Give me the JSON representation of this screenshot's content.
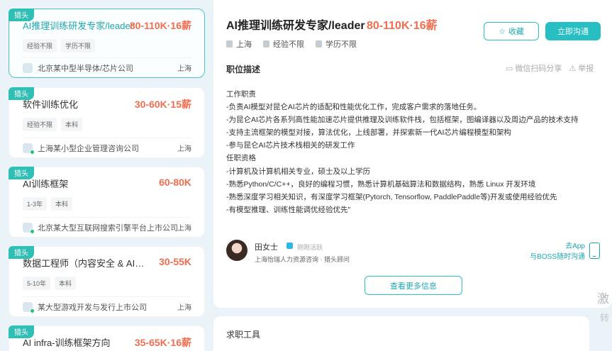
{
  "job_list": [
    {
      "tag": "猎头",
      "title": "AI推理训练研发专家/leader",
      "salary": "80-110K·16薪",
      "tags": [
        "经验不限",
        "学历不限"
      ],
      "company": "北京某中型半导体/芯片公司",
      "city": "上海"
    },
    {
      "tag": "猎头",
      "title": "软件训练优化",
      "salary": "30-60K·15薪",
      "tags": [
        "经验不限",
        "本科"
      ],
      "company": "上海某小型企业管理咨询公司",
      "city": "上海"
    },
    {
      "tag": "猎头",
      "title": "AI训练框架",
      "salary": "60-80K",
      "tags": [
        "1-3年",
        "本科"
      ],
      "company": "北京某大型互联网搜索引擎平台上市公司",
      "city": "上海"
    },
    {
      "tag": "猎头",
      "title": "数据工程师（内容安全 & AI训练...",
      "salary": "30-55K",
      "tags": [
        "5-10年",
        "本科"
      ],
      "company": "某大型游戏开发与发行上市公司",
      "city": "上海"
    },
    {
      "tag": "猎头",
      "title": "AI infra-训练框架方向",
      "salary": "35-65K·16薪",
      "tags": [],
      "company": "",
      "city": ""
    }
  ],
  "header": {
    "title": "AI推理训练研发专家/leader",
    "salary": "80-110K·16薪",
    "city": "上海",
    "experience": "经验不限",
    "education": "学历不限",
    "fav_label": "收藏",
    "chat_label": "立即沟通"
  },
  "description": {
    "section_title": "职位描述",
    "share_label": "微信扫码分享",
    "report_label": "举报",
    "lines": [
      "工作职责",
      "-负责AI模型对昆仑AI芯片的适配和性能优化工作，完成客户需求的落地任务。",
      "-为昆仑AI芯片各系列高性能加速芯片提供推理及训练软件栈，包括框架，图编译器以及周边产品的技术支持",
      "-支持主流框架的模型对接，算法优化，上线部署，并探索新一代AI芯片编程模型和架构",
      "-参与昆仑AI芯片技术栈相关的研发工作",
      "任职资格",
      "-计算机及计算机相关专业，硕士及以上学历",
      "-熟悉Python/C/C++，良好的编程习惯，熟悉计算机基础算法和数据结构，熟悉 Linux 开发环境",
      "-熟悉深度学习相关知识，有深度学习框架(Pytorch, Tensorflow, PaddlePaddle等)开发或使用经验优先",
      "-有模型推理、训练性能调优经验优先\""
    ]
  },
  "recruiter": {
    "name": "田女士",
    "status": "刚刚活跃",
    "company": "上海怡瑞人力资源咨询 · 猎头顾问",
    "app_line1": "去App",
    "app_line2": "与BOSS随时沟通"
  },
  "more_label": "查看更多信息",
  "tools_title": "求职工具",
  "watermark_line1": "激",
  "watermark_line2": "转"
}
